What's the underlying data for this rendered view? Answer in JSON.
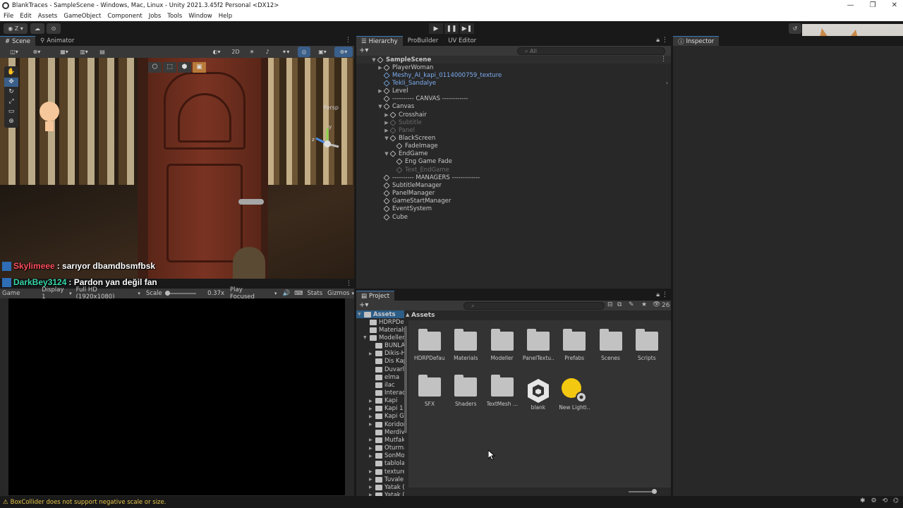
{
  "window": {
    "title": "BlankTraces - SampleScene - Windows, Mac, Linux - Unity 2021.3.45f2 Personal <DX12>",
    "controls": [
      "—",
      "❐",
      "✕"
    ]
  },
  "menu": [
    "File",
    "Edit",
    "Assets",
    "GameObject",
    "Component",
    "Jobs",
    "Tools",
    "Window",
    "Help"
  ],
  "toolbar": {
    "account_label": "Z",
    "play_icons": [
      "▶",
      "❚❚",
      "▶❚"
    ]
  },
  "scene_panel": {
    "tabs": [
      "Scene",
      "Animator"
    ],
    "toggle_2d": "2D",
    "persp_label": "Persp",
    "axis_labels": {
      "y": "y",
      "z": "z"
    },
    "chat": [
      {
        "user": "Skylimeee",
        "user_color": "#ff4e5e",
        "message": ": sarıyor dbamdbsmfbsk"
      },
      {
        "user": "DarkBey3124",
        "user_color": "#36d6a8",
        "message": ": Pardon yan değil fan"
      }
    ]
  },
  "game_panel": {
    "tab": "Game",
    "display": "Display 1",
    "resolution": "Full HD (1920x1080)",
    "scale_label": "Scale",
    "scale_value": "0.37x",
    "play_mode": "Play Focused",
    "stats": "Stats",
    "gizmos": "Gizmos"
  },
  "hierarchy": {
    "tabs": [
      "Hierarchy",
      "ProBuilder",
      "UV Editor"
    ],
    "search_placeholder": "All",
    "items": [
      {
        "label": "SampleScene",
        "indent": 0,
        "style": "scene",
        "arrow": "▼"
      },
      {
        "label": "PlayerWoman",
        "indent": 1,
        "style": "normal",
        "arrow": "▶"
      },
      {
        "label": "Meshy_AI_kapi_0114000759_texture",
        "indent": 1,
        "style": "blue",
        "arrow": ""
      },
      {
        "label": "Tekli_Sandalye",
        "indent": 1,
        "style": "blue",
        "arrow": ""
      },
      {
        "label": "Level",
        "indent": 1,
        "style": "normal",
        "arrow": "▶"
      },
      {
        "label": "---------- CANVAS ------------",
        "indent": 1,
        "style": "normal",
        "arrow": ""
      },
      {
        "label": "Canvas",
        "indent": 1,
        "style": "normal",
        "arrow": "▼"
      },
      {
        "label": "Crosshair",
        "indent": 2,
        "style": "normal",
        "arrow": "▶"
      },
      {
        "label": "Subtitle",
        "indent": 2,
        "style": "dim",
        "arrow": "▶"
      },
      {
        "label": "Panel",
        "indent": 2,
        "style": "dim",
        "arrow": "▶"
      },
      {
        "label": "BlackScreen",
        "indent": 2,
        "style": "normal",
        "arrow": "▼"
      },
      {
        "label": "FadeImage",
        "indent": 3,
        "style": "normal",
        "arrow": ""
      },
      {
        "label": "EndGame",
        "indent": 2,
        "style": "normal",
        "arrow": "▼"
      },
      {
        "label": "Eng Game Fade",
        "indent": 3,
        "style": "normal",
        "arrow": ""
      },
      {
        "label": "Text_EndGame",
        "indent": 3,
        "style": "dim",
        "arrow": ""
      },
      {
        "label": "---------- MANAGERS -------------",
        "indent": 1,
        "style": "normal",
        "arrow": ""
      },
      {
        "label": "SubtitleManager",
        "indent": 1,
        "style": "normal",
        "arrow": ""
      },
      {
        "label": "PanelManager",
        "indent": 1,
        "style": "normal",
        "arrow": ""
      },
      {
        "label": "GameStartManager",
        "indent": 1,
        "style": "normal",
        "arrow": ""
      },
      {
        "label": "EventSystem",
        "indent": 1,
        "style": "normal",
        "arrow": ""
      },
      {
        "label": "Cube",
        "indent": 1,
        "style": "normal",
        "arrow": ""
      }
    ]
  },
  "inspector": {
    "tab": "Inspector"
  },
  "project": {
    "tab": "Project",
    "breadcrumb": "Assets",
    "hidden_count": "26",
    "tree": [
      {
        "label": "Assets",
        "indent": 0,
        "arrow": "▼",
        "selected": true
      },
      {
        "label": "HDRPDef",
        "indent": 1,
        "arrow": ""
      },
      {
        "label": "Materials",
        "indent": 1,
        "arrow": ""
      },
      {
        "label": "Modeller",
        "indent": 1,
        "arrow": "▼"
      },
      {
        "label": "BUNLA",
        "indent": 2,
        "arrow": ""
      },
      {
        "label": "Dikis-H",
        "indent": 2,
        "arrow": "▶"
      },
      {
        "label": "Dis Kap",
        "indent": 2,
        "arrow": ""
      },
      {
        "label": "Duvarl",
        "indent": 2,
        "arrow": ""
      },
      {
        "label": "elma",
        "indent": 2,
        "arrow": ""
      },
      {
        "label": "ilac",
        "indent": 2,
        "arrow": ""
      },
      {
        "label": "Interac",
        "indent": 2,
        "arrow": ""
      },
      {
        "label": "Kapi",
        "indent": 2,
        "arrow": "▶"
      },
      {
        "label": "Kapi 1",
        "indent": 2,
        "arrow": "▶"
      },
      {
        "label": "Kapi Gi",
        "indent": 2,
        "arrow": "▶"
      },
      {
        "label": "Koridor",
        "indent": 2,
        "arrow": "▶"
      },
      {
        "label": "Merdiv",
        "indent": 2,
        "arrow": ""
      },
      {
        "label": "Mutfak",
        "indent": 2,
        "arrow": "▶"
      },
      {
        "label": "Oturma",
        "indent": 2,
        "arrow": "▶"
      },
      {
        "label": "SonMo",
        "indent": 2,
        "arrow": "▶"
      },
      {
        "label": "tablolar",
        "indent": 2,
        "arrow": ""
      },
      {
        "label": "texture",
        "indent": 2,
        "arrow": "▶"
      },
      {
        "label": "Tuvale",
        "indent": 2,
        "arrow": "▶"
      },
      {
        "label": "Yatak (",
        "indent": 2,
        "arrow": "▶"
      },
      {
        "label": "Yatak (",
        "indent": 2,
        "arrow": "▶"
      }
    ],
    "assets": [
      {
        "label": "HDRPDefau...",
        "kind": "folder"
      },
      {
        "label": "Materials",
        "kind": "folder"
      },
      {
        "label": "Modeller",
        "kind": "folder"
      },
      {
        "label": "PanelTextu...",
        "kind": "folder"
      },
      {
        "label": "Prefabs",
        "kind": "folder"
      },
      {
        "label": "Scenes",
        "kind": "folder"
      },
      {
        "label": "Scripts",
        "kind": "folder"
      },
      {
        "label": "SFX",
        "kind": "folder"
      },
      {
        "label": "Shaders",
        "kind": "folder"
      },
      {
        "label": "TextMesh ...",
        "kind": "folder"
      },
      {
        "label": "blank",
        "kind": "unity"
      },
      {
        "label": "New Lighti...",
        "kind": "lighting"
      }
    ]
  },
  "status": {
    "message": "BoxCollider does not support negative scale or size.",
    "color": "#e8c64a"
  }
}
